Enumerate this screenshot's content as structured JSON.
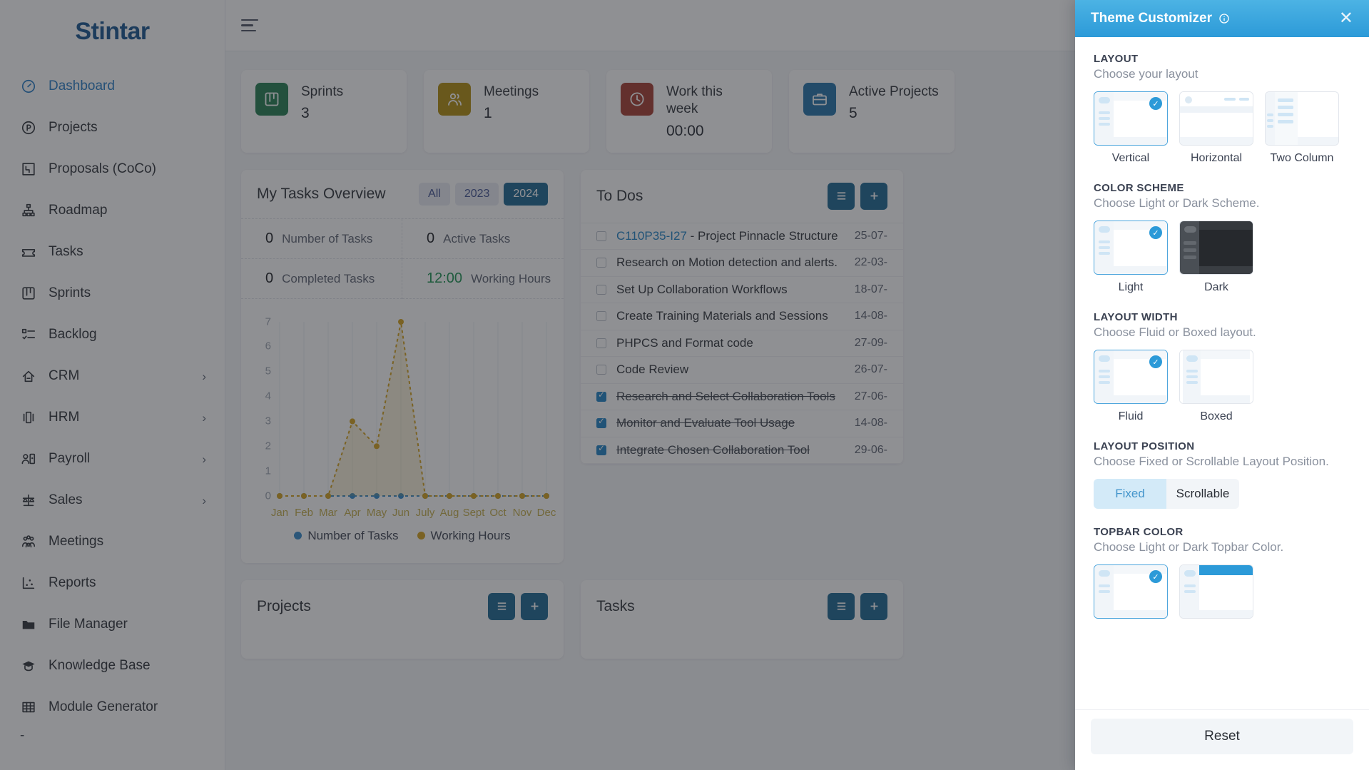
{
  "brand": {
    "name": "Stintar"
  },
  "sidebar": {
    "items": [
      {
        "label": "Dashboard",
        "icon": "gauge-icon",
        "active": true,
        "caret": false
      },
      {
        "label": "Projects",
        "icon": "circle-p-icon",
        "active": false,
        "caret": false
      },
      {
        "label": "Proposals (CoCo)",
        "icon": "proposal-icon",
        "active": false,
        "caret": false
      },
      {
        "label": "Roadmap",
        "icon": "roadmap-icon",
        "active": false,
        "caret": false
      },
      {
        "label": "Tasks",
        "icon": "ticket-icon",
        "active": false,
        "caret": false
      },
      {
        "label": "Sprints",
        "icon": "board-icon",
        "active": false,
        "caret": false
      },
      {
        "label": "Backlog",
        "icon": "checklist-icon",
        "active": false,
        "caret": false
      },
      {
        "label": "CRM",
        "icon": "handshake-icon",
        "active": false,
        "caret": true
      },
      {
        "label": "HRM",
        "icon": "people-cards-icon",
        "active": false,
        "caret": true
      },
      {
        "label": "Payroll",
        "icon": "person-badge-icon",
        "active": false,
        "caret": true
      },
      {
        "label": "Sales",
        "icon": "scales-icon",
        "active": false,
        "caret": true
      },
      {
        "label": "Meetings",
        "icon": "group-icon",
        "active": false,
        "caret": false
      },
      {
        "label": "Reports",
        "icon": "scatter-chart-icon",
        "active": false,
        "caret": false
      },
      {
        "label": "File Manager",
        "icon": "folder-icon",
        "active": false,
        "caret": false
      },
      {
        "label": "Knowledge Base",
        "icon": "graduation-cap-icon",
        "active": false,
        "caret": false
      },
      {
        "label": "Module Generator",
        "icon": "grid-table-icon",
        "active": false,
        "caret": false
      }
    ],
    "trailing_dash": "-"
  },
  "topbar": {
    "menu_toggle": "hamburger-icon",
    "language_flag": "us-flag-icon",
    "settings_icon": "gear-icon"
  },
  "stats": [
    {
      "label": "Sprints",
      "value": "3",
      "icon": "board-icon",
      "color": "#1f7a4d"
    },
    {
      "label": "Meetings",
      "value": "1",
      "icon": "people-icon",
      "color": "#b08a08"
    },
    {
      "label": "Work this week",
      "value": "00:00",
      "icon": "clock-icon",
      "color": "#a3382a"
    },
    {
      "label": "Active Projects",
      "value": "5",
      "icon": "suitcase-icon",
      "color": "#1f6fa8"
    }
  ],
  "tasks_overview": {
    "title": "My Tasks Overview",
    "filters": [
      {
        "label": "All",
        "active": false
      },
      {
        "label": "2023",
        "active": false
      },
      {
        "label": "2024",
        "active": true
      }
    ],
    "kpis": [
      {
        "value": "0",
        "label": "Number of Tasks",
        "accent": "dark"
      },
      {
        "value": "0",
        "label": "Active Tasks",
        "accent": "dark"
      },
      {
        "value": "0",
        "label": "Completed Tasks",
        "accent": "dark"
      },
      {
        "value": "12:00",
        "label": "Working Hours",
        "accent": "green"
      }
    ]
  },
  "chart_data": {
    "type": "area",
    "title": "My Tasks Overview",
    "xlabel": "",
    "ylabel": "",
    "x": [
      "Jan",
      "Feb",
      "Mar",
      "Apr",
      "May",
      "Jun",
      "July",
      "Aug",
      "Sept",
      "Oct",
      "Nov",
      "Dec"
    ],
    "ylim": [
      0,
      7
    ],
    "yticks": [
      0,
      1,
      2,
      3,
      4,
      5,
      6,
      7
    ],
    "grid": true,
    "legend_position": "bottom",
    "series": [
      {
        "name": "Number of Tasks",
        "color": "#2e86c9",
        "values": [
          0,
          0,
          0,
          0,
          0,
          0,
          0,
          0,
          0,
          0,
          0,
          0
        ]
      },
      {
        "name": "Working Hours",
        "color": "#d4a017",
        "values": [
          0,
          0,
          0,
          3,
          2,
          7,
          0,
          0,
          0,
          0,
          0,
          0
        ]
      }
    ]
  },
  "todos": {
    "title": "To Dos",
    "list_icon": "list-icon",
    "add_icon": "plus-icon",
    "items": [
      {
        "code": "C110P35-I27",
        "text": " - Project Pinnacle Structure",
        "date": "25-07-",
        "checked": false
      },
      {
        "code": "",
        "text": "Research on Motion detection and alerts.",
        "date": "22-03-",
        "checked": false
      },
      {
        "code": "",
        "text": "Set Up Collaboration Workflows",
        "date": "18-07-",
        "checked": false
      },
      {
        "code": "",
        "text": "Create Training Materials and Sessions",
        "date": "14-08-",
        "checked": false
      },
      {
        "code": "",
        "text": "PHPCS and Format code",
        "date": "27-09-",
        "checked": false
      },
      {
        "code": "",
        "text": "Code Review",
        "date": "26-07-",
        "checked": false
      },
      {
        "code": "",
        "text": "Research and Select Collaboration Tools",
        "date": "27-06-",
        "checked": true
      },
      {
        "code": "",
        "text": "Monitor and Evaluate Tool Usage",
        "date": "14-08-",
        "checked": true
      },
      {
        "code": "",
        "text": "Integrate Chosen Collaboration Tool",
        "date": "29-06-",
        "checked": true
      }
    ]
  },
  "bottom_panels": [
    {
      "title": "Projects",
      "list_icon": "list-icon",
      "add_icon": "plus-icon",
      "has_add": true
    },
    {
      "title": "Tasks",
      "list_icon": "list-icon",
      "add_icon": "plus-icon",
      "has_add": true
    }
  ],
  "customizer": {
    "title": "Theme Customizer",
    "info_icon": "info-icon",
    "close_icon": "close-icon",
    "sections": [
      {
        "heading": "LAYOUT",
        "subheading": "Choose your layout",
        "options": [
          {
            "label": "Vertical",
            "selected": true
          },
          {
            "label": "Horizontal",
            "selected": false
          },
          {
            "label": "Two Column",
            "selected": false
          }
        ]
      },
      {
        "heading": "COLOR SCHEME",
        "subheading": "Choose Light or Dark Scheme.",
        "options": [
          {
            "label": "Light",
            "selected": true
          },
          {
            "label": "Dark",
            "selected": false
          }
        ]
      },
      {
        "heading": "LAYOUT WIDTH",
        "subheading": "Choose Fluid or Boxed layout.",
        "options": [
          {
            "label": "Fluid",
            "selected": true
          },
          {
            "label": "Boxed",
            "selected": false
          }
        ]
      },
      {
        "heading": "LAYOUT POSITION",
        "subheading": "Choose Fixed or Scrollable Layout Position.",
        "segments": [
          {
            "label": "Fixed",
            "selected": true
          },
          {
            "label": "Scrollable",
            "selected": false
          }
        ]
      },
      {
        "heading": "TOPBAR COLOR",
        "subheading": "Choose Light or Dark Topbar Color.",
        "options": [
          {
            "label": "",
            "selected": true
          },
          {
            "label": "",
            "selected": false
          }
        ]
      }
    ],
    "reset_label": "Reset",
    "accent_color": "#2c9ad8"
  }
}
